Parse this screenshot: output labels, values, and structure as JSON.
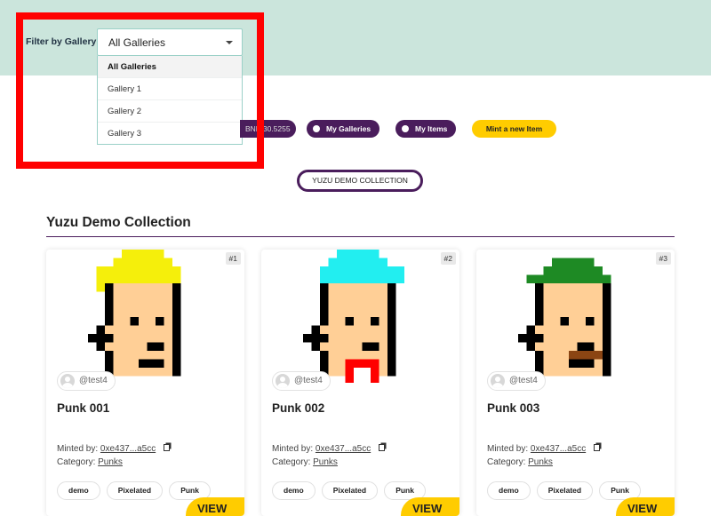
{
  "filter": {
    "label": "Filter by Gallery",
    "selected": "All Galleries",
    "options": [
      "All Galleries",
      "Gallery 1",
      "Gallery 2",
      "Gallery 3"
    ]
  },
  "nav": {
    "balance": "BNB 30.5255",
    "my_galleries": "My Galleries",
    "my_items": "My Items",
    "mint": "Mint a new Item"
  },
  "collection_button": "YUZU DEMO COLLECTION",
  "section_title": "Yuzu Demo Collection",
  "cards": [
    {
      "badge": "#1",
      "owner": "@test4",
      "title": "Punk 001",
      "minted_label": "Minted by:",
      "minted_by": "0xe437...a5cc",
      "category_label": "Category:",
      "category": "Punks",
      "tags": [
        "demo",
        "Pixelated",
        "Punk"
      ],
      "view": "VIEW",
      "hair_color": "#f5ef0b"
    },
    {
      "badge": "#2",
      "owner": "@test4",
      "title": "Punk 002",
      "minted_label": "Minted by:",
      "minted_by": "0xe437...a5cc",
      "category_label": "Category:",
      "category": "Punks",
      "tags": [
        "demo",
        "Pixelated",
        "Punk"
      ],
      "view": "VIEW",
      "hair_color": "#22eef0"
    },
    {
      "badge": "#3",
      "owner": "@test4",
      "title": "Punk 003",
      "minted_label": "Minted by:",
      "minted_by": "0xe437...a5cc",
      "category_label": "Category:",
      "category": "Punks",
      "tags": [
        "demo",
        "Pixelated",
        "Punk"
      ],
      "view": "VIEW",
      "hair_color": "#1e8a24"
    }
  ],
  "colors": {
    "hero_bg": "#cbe5dc",
    "accent_purple": "#4a1d5c",
    "accent_yellow": "#ffcc00",
    "highlight_red": "#ff0000",
    "skin": "#ffcf96"
  }
}
